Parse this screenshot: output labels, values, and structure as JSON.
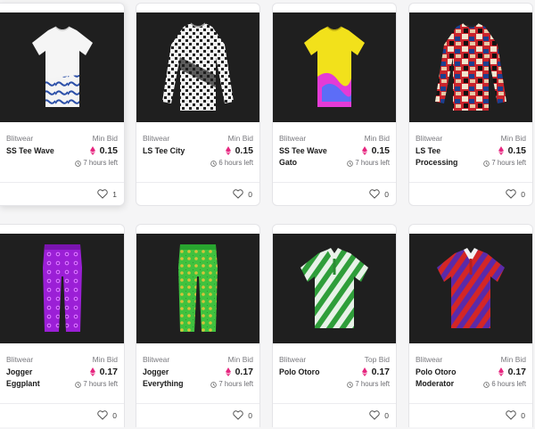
{
  "accent_color": "#e6267f",
  "cards": [
    {
      "brand": "Blitwear",
      "name": "SS Tee Wave",
      "bid_label": "Min Bid",
      "price": "0.15",
      "time_left": "7 hours left",
      "likes": "1",
      "image": "short-sleeve-tee-wave-print"
    },
    {
      "brand": "Blitwear",
      "name": "LS Tee City",
      "bid_label": "Min Bid",
      "price": "0.15",
      "time_left": "6 hours left",
      "likes": "0",
      "image": "long-sleeve-tee-city-print"
    },
    {
      "brand": "Blitwear",
      "name": "SS Tee Wave Gato",
      "bid_label": "Min Bid",
      "price": "0.15",
      "time_left": "7 hours left",
      "likes": "0",
      "image": "short-sleeve-tee-yellow-wave"
    },
    {
      "brand": "Blitwear",
      "name": "LS Tee Processing",
      "bid_label": "Min Bid",
      "price": "0.15",
      "time_left": "7 hours left",
      "likes": "0",
      "image": "long-sleeve-tee-patchwork"
    },
    {
      "brand": "Blitwear",
      "name": "Jogger Eggplant",
      "bid_label": "Min Bid",
      "price": "0.17",
      "time_left": "7 hours left",
      "likes": "0",
      "image": "jogger-purple"
    },
    {
      "brand": "Blitwear",
      "name": "Jogger Everything",
      "bid_label": "Min Bid",
      "price": "0.17",
      "time_left": "7 hours left",
      "likes": "0",
      "image": "jogger-green"
    },
    {
      "brand": "Blitwear",
      "name": "Polo Otoro",
      "bid_label": "Top Bid",
      "price": "0.17",
      "time_left": "7 hours left",
      "likes": "0",
      "image": "polo-green-stripes"
    },
    {
      "brand": "Blitwear",
      "name": "Polo Otoro Moderator",
      "bid_label": "Min Bid",
      "price": "0.17",
      "time_left": "6 hours left",
      "likes": "0",
      "image": "polo-red-purple-stripes"
    }
  ]
}
